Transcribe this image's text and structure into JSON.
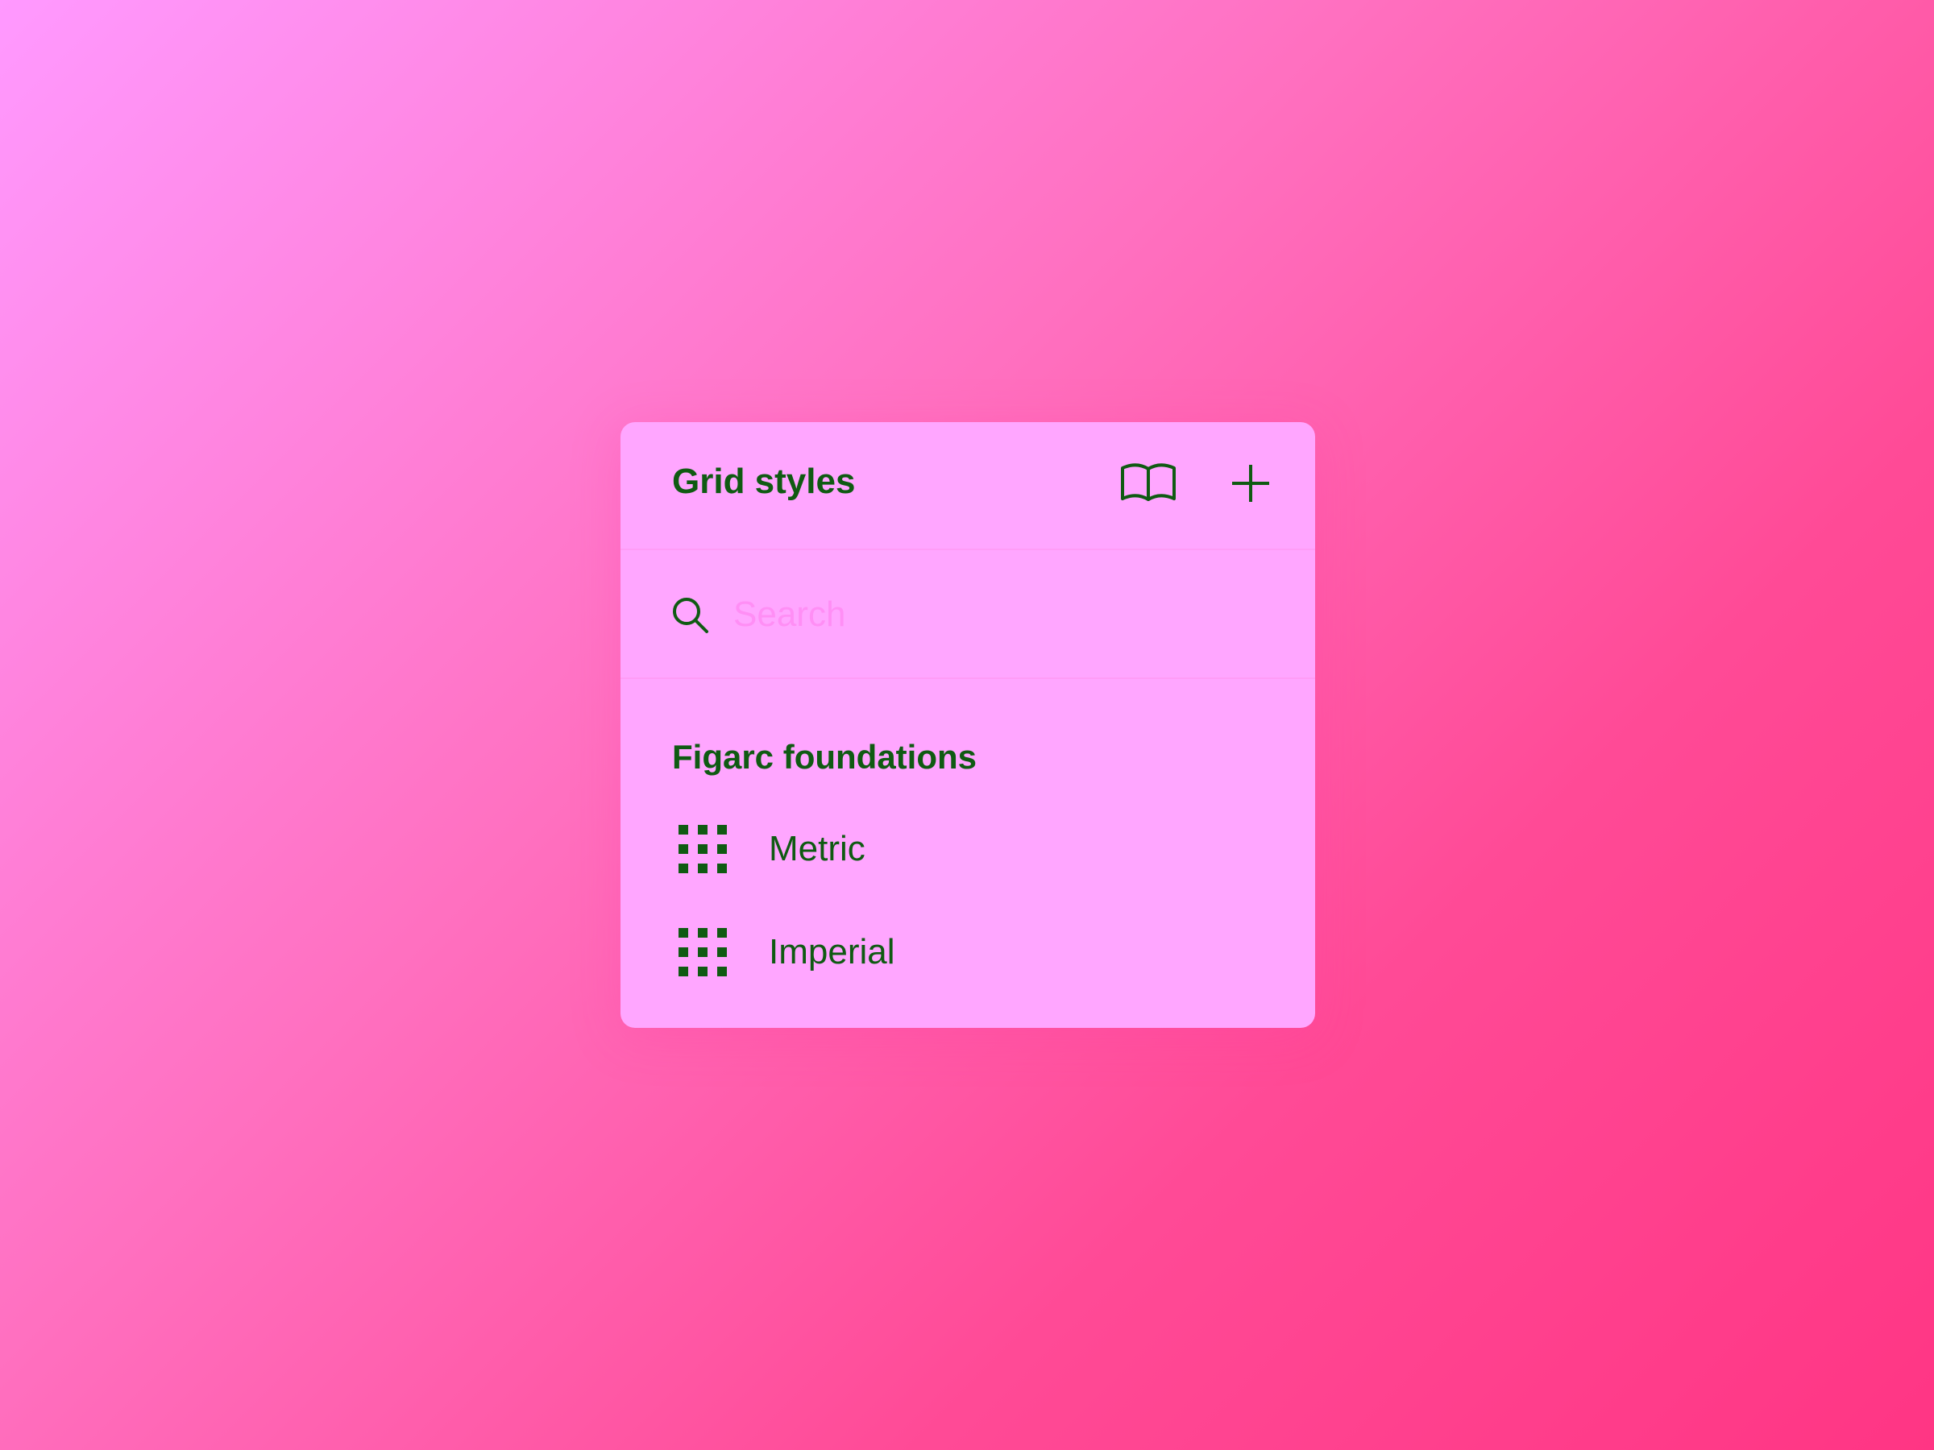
{
  "panel": {
    "title": "Grid styles",
    "library_icon": "book-open-icon",
    "add_icon": "plus-icon"
  },
  "search": {
    "icon": "search-icon",
    "placeholder": "Search",
    "value": ""
  },
  "section": {
    "heading": "Figarc foundations",
    "items": [
      {
        "label": "Metric",
        "icon": "grid-style-icon"
      },
      {
        "label": "Imperial",
        "icon": "grid-style-icon"
      }
    ]
  },
  "colors": {
    "background_start": "#ff99ff",
    "background_end": "#ff3584",
    "panel": "#ffa6ff",
    "text": "#0f5a12",
    "placeholder": "#ff8ef5"
  }
}
